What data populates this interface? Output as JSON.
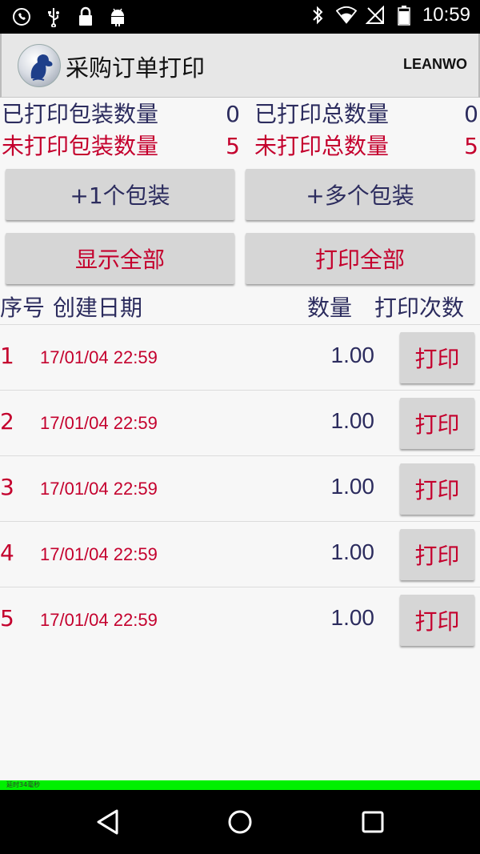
{
  "status_bar": {
    "time": "10:59",
    "left_icons": [
      "whatsapp-icon",
      "usb-icon",
      "lock-icon",
      "android-icon"
    ],
    "right_icons": [
      "bluetooth-icon",
      "wifi-icon",
      "no-sim-icon",
      "battery-icon"
    ]
  },
  "header": {
    "title": "采购订单打印",
    "brand": "LEANWO"
  },
  "stats": {
    "printed_packages_label": "已打印包装数量",
    "printed_packages_value": "0",
    "printed_total_label": "已打印总数量",
    "printed_total_value": "0",
    "unprinted_packages_label": "未打印包装数量",
    "unprinted_packages_value": "5",
    "unprinted_total_label": "未打印总数量",
    "unprinted_total_value": "5"
  },
  "buttons": {
    "add_one": "+1个包装",
    "add_many": "+多个包装",
    "show_all": "显示全部",
    "print_all": "打印全部"
  },
  "table": {
    "headers": {
      "index": "序号",
      "date": "创建日期",
      "qty": "数量",
      "print_count": "打印次数"
    },
    "rows": [
      {
        "index": "1",
        "date": "17/01/04 22:59",
        "qty": "1.00",
        "action": "打印"
      },
      {
        "index": "2",
        "date": "17/01/04 22:59",
        "qty": "1.00",
        "action": "打印"
      },
      {
        "index": "3",
        "date": "17/01/04 22:59",
        "qty": "1.00",
        "action": "打印"
      },
      {
        "index": "4",
        "date": "17/01/04 22:59",
        "qty": "1.00",
        "action": "打印"
      },
      {
        "index": "5",
        "date": "17/01/04 22:59",
        "qty": "1.00",
        "action": "打印"
      }
    ]
  },
  "footer": {
    "latency_text": "延时34毫秒"
  },
  "colors": {
    "dark_text": "#2c2c5e",
    "red_text": "#c4002d",
    "button_bg": "#d6d6d6",
    "latency_bar": "#00f000"
  },
  "nav_icons": [
    "back-icon",
    "home-icon",
    "recents-icon"
  ]
}
